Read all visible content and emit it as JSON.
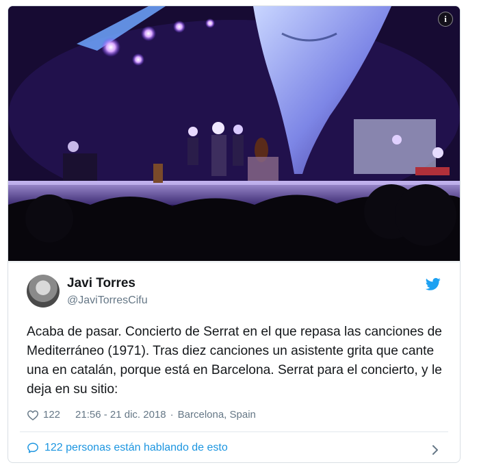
{
  "tweet": {
    "author_name": "Javi Torres",
    "author_handle": "@JaviTorresCifu",
    "text": "Acaba de pasar. Concierto de Serrat en el que repasa las canciones de Mediterráneo (1971). Tras diez canciones un asistente grita que cante una en catalán, porque está en Barcelona. Serrat para el concierto, y le deja en su sitio:",
    "like_count": "122",
    "timestamp": "21:56 - 21 dic. 2018",
    "separator": "·",
    "location": "Barcelona, Spain",
    "conversation_label": "122 personas están hablando de esto"
  },
  "media": {
    "info_symbol": "i"
  },
  "icons": {
    "info": "info-icon",
    "twitter": "twitter-bird-icon",
    "like": "heart-icon",
    "reply": "speech-bubble-icon",
    "expand": "chevron-right-icon"
  },
  "colors": {
    "twitter_blue": "#1b95e0",
    "text_primary": "#14171a",
    "text_secondary": "#657786",
    "border": "#d8dee3"
  }
}
